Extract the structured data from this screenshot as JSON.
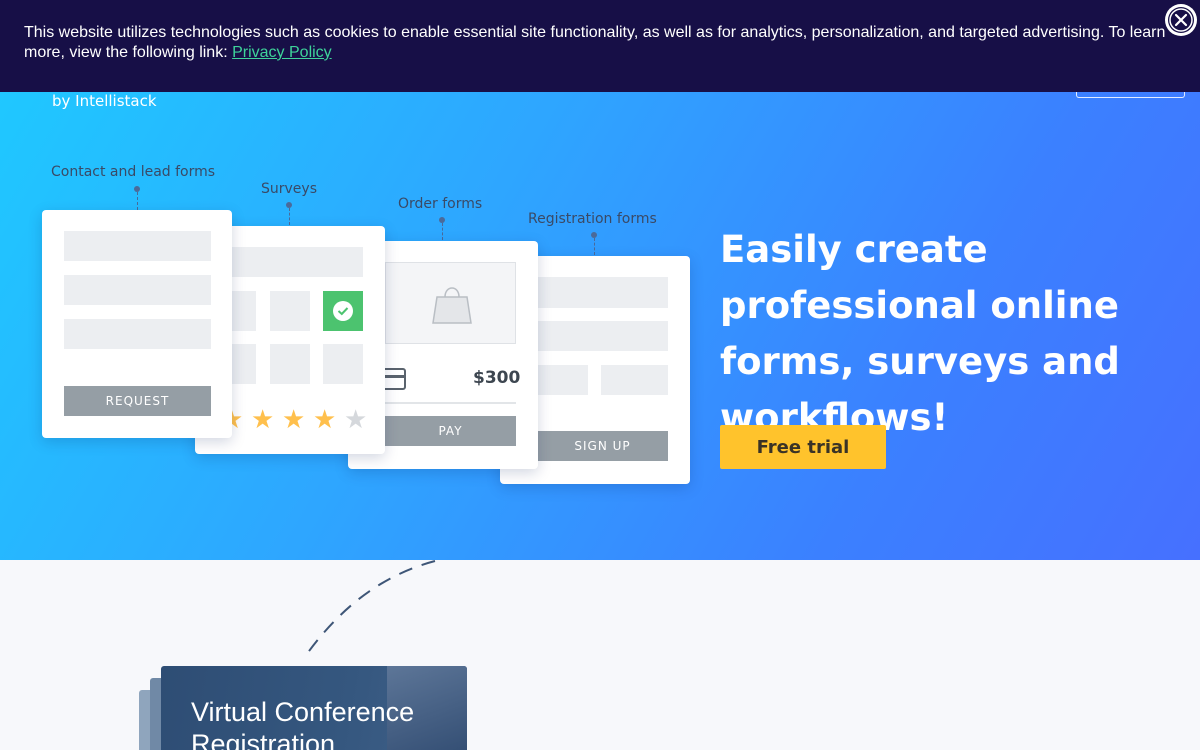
{
  "cookie_banner": {
    "text": "This website utilizes technologies such as cookies to enable essential site functionality, as well as for analytics, personalization, and targeted advertising. To learn more, view the following link: ",
    "link_label": "Privacy Policy",
    "close_icon": "close-circle-icon"
  },
  "brand": {
    "byline": "by Intellistack"
  },
  "illustration": {
    "categories": {
      "contact": "Contact and lead forms",
      "surveys": "Surveys",
      "order": "Order forms",
      "registration": "Registration forms"
    },
    "request_button": "REQUEST",
    "pay_button": "PAY",
    "signup_button": "SIGN UP",
    "price": "$300",
    "rating": {
      "filled": 4,
      "total": 5
    },
    "icons": [
      "check-icon",
      "shopping-bag-icon",
      "credit-card-icon",
      "star-icon"
    ]
  },
  "hero": {
    "headline": "Easily create professional online forms, surveys and workflows!",
    "cta_label": "Free trial"
  },
  "template_preview": {
    "title": "Virtual Conference Registration"
  },
  "colors": {
    "banner_bg": "#170f47",
    "link": "#3ed39a",
    "cta": "#ffc32c",
    "hero_from": "#1ecbff",
    "hero_to": "#4670ff",
    "star_on": "#ffc04d",
    "star_off": "#d5d8dc"
  }
}
